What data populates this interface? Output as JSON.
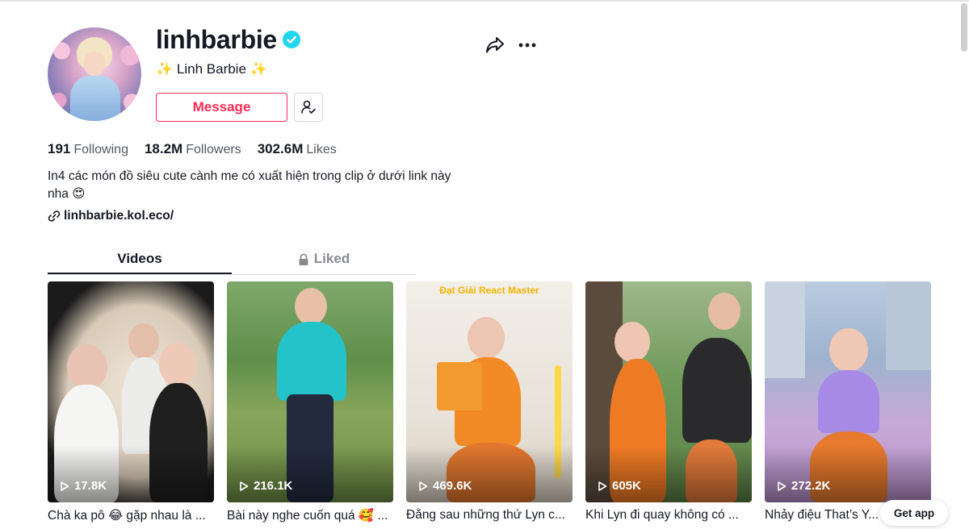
{
  "profile": {
    "username": "linhbarbie",
    "nickname": "Linh Barbie",
    "sparkle_left": "✨",
    "sparkle_right": "✨",
    "verified": true,
    "message_label": "Message",
    "bio_line1": "In4 các món đồ siêu cute cành me có xuất hiện trong clip ở dưới link này",
    "bio_line2": "nha 😍",
    "link": "linhbarbie.kol.eco/"
  },
  "stats": {
    "following_count": "191",
    "following_label": "Following",
    "followers_count": "18.2M",
    "followers_label": "Followers",
    "likes_count": "302.6M",
    "likes_label": "Likes"
  },
  "tabs": [
    {
      "label": "Videos",
      "active": true
    },
    {
      "label": "Liked",
      "active": false,
      "icon": "lock-icon"
    }
  ],
  "videos": [
    {
      "views": "17.8K",
      "caption": "Chà ka pô 😂 gặp nhau là ..."
    },
    {
      "views": "216.1K",
      "caption": "Bài này nghe cuốn quá 🥰 ..."
    },
    {
      "views": "469.6K",
      "caption": "Đằng sau những thứ Lyn c...",
      "overlay_text": "Đạt Giải React Master"
    },
    {
      "views": "605K",
      "caption": "Khi Lyn đi quay không có ..."
    },
    {
      "views": "272.2K",
      "caption": "Nhảy điệu That’s Y..."
    }
  ],
  "get_app_label": "Get app",
  "colors": {
    "accent": "#fe2c55",
    "verified": "#20d5ec",
    "text": "#161823",
    "muted": "#8a8b91"
  }
}
